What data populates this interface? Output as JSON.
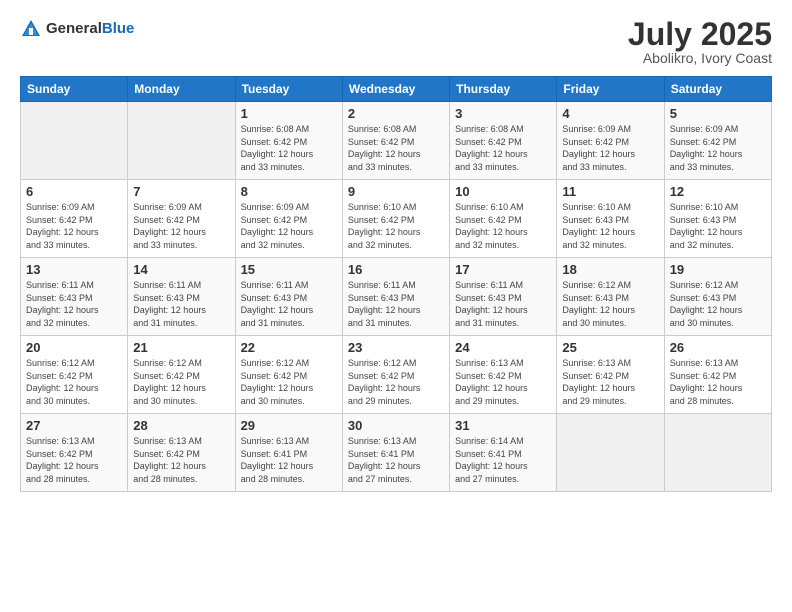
{
  "header": {
    "logo_general": "General",
    "logo_blue": "Blue",
    "month_year": "July 2025",
    "location": "Abolikro, Ivory Coast"
  },
  "weekdays": [
    "Sunday",
    "Monday",
    "Tuesday",
    "Wednesday",
    "Thursday",
    "Friday",
    "Saturday"
  ],
  "weeks": [
    [
      {
        "day": "",
        "detail": ""
      },
      {
        "day": "",
        "detail": ""
      },
      {
        "day": "1",
        "detail": "Sunrise: 6:08 AM\nSunset: 6:42 PM\nDaylight: 12 hours\nand 33 minutes."
      },
      {
        "day": "2",
        "detail": "Sunrise: 6:08 AM\nSunset: 6:42 PM\nDaylight: 12 hours\nand 33 minutes."
      },
      {
        "day": "3",
        "detail": "Sunrise: 6:08 AM\nSunset: 6:42 PM\nDaylight: 12 hours\nand 33 minutes."
      },
      {
        "day": "4",
        "detail": "Sunrise: 6:09 AM\nSunset: 6:42 PM\nDaylight: 12 hours\nand 33 minutes."
      },
      {
        "day": "5",
        "detail": "Sunrise: 6:09 AM\nSunset: 6:42 PM\nDaylight: 12 hours\nand 33 minutes."
      }
    ],
    [
      {
        "day": "6",
        "detail": "Sunrise: 6:09 AM\nSunset: 6:42 PM\nDaylight: 12 hours\nand 33 minutes."
      },
      {
        "day": "7",
        "detail": "Sunrise: 6:09 AM\nSunset: 6:42 PM\nDaylight: 12 hours\nand 33 minutes."
      },
      {
        "day": "8",
        "detail": "Sunrise: 6:09 AM\nSunset: 6:42 PM\nDaylight: 12 hours\nand 32 minutes."
      },
      {
        "day": "9",
        "detail": "Sunrise: 6:10 AM\nSunset: 6:42 PM\nDaylight: 12 hours\nand 32 minutes."
      },
      {
        "day": "10",
        "detail": "Sunrise: 6:10 AM\nSunset: 6:42 PM\nDaylight: 12 hours\nand 32 minutes."
      },
      {
        "day": "11",
        "detail": "Sunrise: 6:10 AM\nSunset: 6:43 PM\nDaylight: 12 hours\nand 32 minutes."
      },
      {
        "day": "12",
        "detail": "Sunrise: 6:10 AM\nSunset: 6:43 PM\nDaylight: 12 hours\nand 32 minutes."
      }
    ],
    [
      {
        "day": "13",
        "detail": "Sunrise: 6:11 AM\nSunset: 6:43 PM\nDaylight: 12 hours\nand 32 minutes."
      },
      {
        "day": "14",
        "detail": "Sunrise: 6:11 AM\nSunset: 6:43 PM\nDaylight: 12 hours\nand 31 minutes."
      },
      {
        "day": "15",
        "detail": "Sunrise: 6:11 AM\nSunset: 6:43 PM\nDaylight: 12 hours\nand 31 minutes."
      },
      {
        "day": "16",
        "detail": "Sunrise: 6:11 AM\nSunset: 6:43 PM\nDaylight: 12 hours\nand 31 minutes."
      },
      {
        "day": "17",
        "detail": "Sunrise: 6:11 AM\nSunset: 6:43 PM\nDaylight: 12 hours\nand 31 minutes."
      },
      {
        "day": "18",
        "detail": "Sunrise: 6:12 AM\nSunset: 6:43 PM\nDaylight: 12 hours\nand 30 minutes."
      },
      {
        "day": "19",
        "detail": "Sunrise: 6:12 AM\nSunset: 6:43 PM\nDaylight: 12 hours\nand 30 minutes."
      }
    ],
    [
      {
        "day": "20",
        "detail": "Sunrise: 6:12 AM\nSunset: 6:42 PM\nDaylight: 12 hours\nand 30 minutes."
      },
      {
        "day": "21",
        "detail": "Sunrise: 6:12 AM\nSunset: 6:42 PM\nDaylight: 12 hours\nand 30 minutes."
      },
      {
        "day": "22",
        "detail": "Sunrise: 6:12 AM\nSunset: 6:42 PM\nDaylight: 12 hours\nand 30 minutes."
      },
      {
        "day": "23",
        "detail": "Sunrise: 6:12 AM\nSunset: 6:42 PM\nDaylight: 12 hours\nand 29 minutes."
      },
      {
        "day": "24",
        "detail": "Sunrise: 6:13 AM\nSunset: 6:42 PM\nDaylight: 12 hours\nand 29 minutes."
      },
      {
        "day": "25",
        "detail": "Sunrise: 6:13 AM\nSunset: 6:42 PM\nDaylight: 12 hours\nand 29 minutes."
      },
      {
        "day": "26",
        "detail": "Sunrise: 6:13 AM\nSunset: 6:42 PM\nDaylight: 12 hours\nand 28 minutes."
      }
    ],
    [
      {
        "day": "27",
        "detail": "Sunrise: 6:13 AM\nSunset: 6:42 PM\nDaylight: 12 hours\nand 28 minutes."
      },
      {
        "day": "28",
        "detail": "Sunrise: 6:13 AM\nSunset: 6:42 PM\nDaylight: 12 hours\nand 28 minutes."
      },
      {
        "day": "29",
        "detail": "Sunrise: 6:13 AM\nSunset: 6:41 PM\nDaylight: 12 hours\nand 28 minutes."
      },
      {
        "day": "30",
        "detail": "Sunrise: 6:13 AM\nSunset: 6:41 PM\nDaylight: 12 hours\nand 27 minutes."
      },
      {
        "day": "31",
        "detail": "Sunrise: 6:14 AM\nSunset: 6:41 PM\nDaylight: 12 hours\nand 27 minutes."
      },
      {
        "day": "",
        "detail": ""
      },
      {
        "day": "",
        "detail": ""
      }
    ]
  ]
}
